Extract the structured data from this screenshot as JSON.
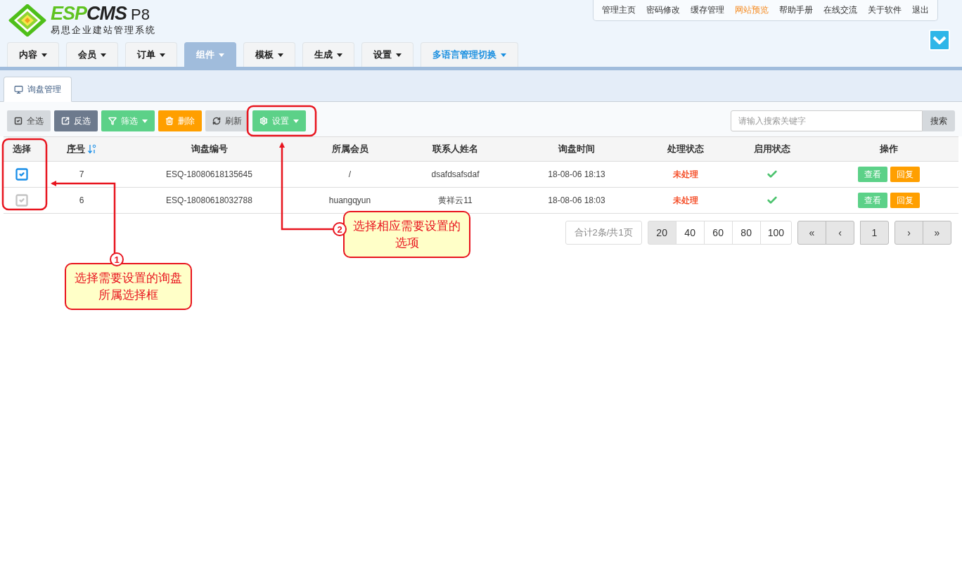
{
  "logo": {
    "brand_a": "ESP",
    "brand_b": "CMS",
    "version": "P8",
    "subtitle": "易思企业建站管理系统"
  },
  "top_links": [
    {
      "label": "管理主页",
      "highlight": false
    },
    {
      "label": "密码修改",
      "highlight": false
    },
    {
      "label": "缓存管理",
      "highlight": false
    },
    {
      "label": "网站预览",
      "highlight": true
    },
    {
      "label": "帮助手册",
      "highlight": false
    },
    {
      "label": "在线交流",
      "highlight": false
    },
    {
      "label": "关于软件",
      "highlight": false
    },
    {
      "label": "退出",
      "highlight": false
    }
  ],
  "nav": [
    {
      "label": "内容",
      "selected": false,
      "highlight": false
    },
    {
      "label": "会员",
      "selected": false,
      "highlight": false
    },
    {
      "label": "订单",
      "selected": false,
      "highlight": false
    },
    {
      "label": "组件",
      "selected": true,
      "highlight": false
    },
    {
      "label": "模板",
      "selected": false,
      "highlight": false
    },
    {
      "label": "生成",
      "selected": false,
      "highlight": false
    },
    {
      "label": "设置",
      "selected": false,
      "highlight": false
    },
    {
      "label": "多语言管理切换",
      "selected": false,
      "highlight": true
    }
  ],
  "page_tab": {
    "label": "询盘管理"
  },
  "toolbar": [
    {
      "kind": "select_all",
      "label": "全选",
      "color": "#d5d9dd",
      "dropdown": false
    },
    {
      "kind": "invert",
      "label": "反选",
      "color": "#6d7a8d",
      "dropdown": false
    },
    {
      "kind": "filter",
      "label": "筛选",
      "color": "#5cd188",
      "dropdown": true
    },
    {
      "kind": "delete",
      "label": "删除",
      "color": "#ff9f00",
      "dropdown": false
    },
    {
      "kind": "refresh",
      "label": "刷新",
      "color": "#d5d9dd",
      "dropdown": false
    },
    {
      "kind": "settings",
      "label": "设置",
      "color": "#5cd188",
      "dropdown": true
    }
  ],
  "search": {
    "placeholder": "请输入搜索关键字",
    "button": "搜索"
  },
  "table": {
    "columns": [
      "选择",
      "序号",
      "询盘编号",
      "所属会员",
      "联系人姓名",
      "询盘时间",
      "处理状态",
      "启用状态",
      "操作"
    ],
    "rows": [
      {
        "checked": true,
        "id": "7",
        "code": "ESQ-18080618135645",
        "member": "/",
        "contact": "dsafdsafsdaf",
        "time": "18-08-06 18:13",
        "status": "未处理",
        "enabled": true,
        "actions": [
          "查看",
          "回复"
        ]
      },
      {
        "checked": false,
        "id": "6",
        "code": "ESQ-18080618032788",
        "member": "huangqyun",
        "contact": "黄祥云11",
        "time": "18-08-06 18:03",
        "status": "未处理",
        "enabled": true,
        "actions": [
          "查看",
          "回复"
        ]
      }
    ]
  },
  "pagination": {
    "summary": "合计2条/共1页",
    "sizes": [
      {
        "label": "20",
        "selected": true
      },
      {
        "label": "40",
        "selected": false
      },
      {
        "label": "60",
        "selected": false
      },
      {
        "label": "80",
        "selected": false
      },
      {
        "label": "100",
        "selected": false
      }
    ],
    "nav": [
      {
        "kind": "first",
        "label": "«"
      },
      {
        "kind": "prev",
        "label": "‹"
      },
      {
        "kind": "page",
        "label": "1"
      },
      {
        "kind": "next",
        "label": "›"
      },
      {
        "kind": "last",
        "label": "»"
      }
    ]
  },
  "annotations": [
    {
      "number": "1",
      "text": "选择需要设置的询盘所属选择框"
    },
    {
      "number": "2",
      "text": "选择相应需要设置的选项"
    }
  ]
}
